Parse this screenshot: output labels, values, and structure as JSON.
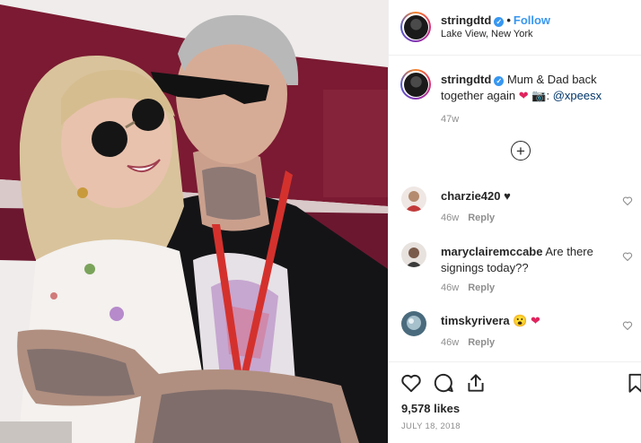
{
  "post": {
    "username": "stringdtd",
    "follow_label": "Follow",
    "separator": "•",
    "location": "Lake View, New York",
    "caption": {
      "username": "stringdtd",
      "text_before": "Mum & Dad back together again",
      "heart": "❤",
      "camera": "📷",
      "colon": ":",
      "mention": "@xpeesx",
      "time": "47w"
    },
    "load_more_symbol": "+",
    "comments": [
      {
        "username": "charzie420",
        "text": "♥",
        "time": "46w",
        "reply": "Reply"
      },
      {
        "username": "maryclairemccabe",
        "text": "Are there signings today??",
        "time": "46w",
        "reply": "Reply"
      },
      {
        "username": "timskyrivera",
        "text": "😮 ❤",
        "time": "46w",
        "reply": "Reply"
      }
    ],
    "likes": "9,578 likes",
    "date": "JULY 18, 2018"
  },
  "colors": {
    "link_blue": "#3897f0",
    "mention_blue": "#003569",
    "heart_red": "#e0245e",
    "muted": "#8e8e8e"
  },
  "icons": [
    "verified-badge-icon",
    "add-circle-icon",
    "heart-outline-icon",
    "comment-icon",
    "share-icon",
    "bookmark-icon"
  ]
}
